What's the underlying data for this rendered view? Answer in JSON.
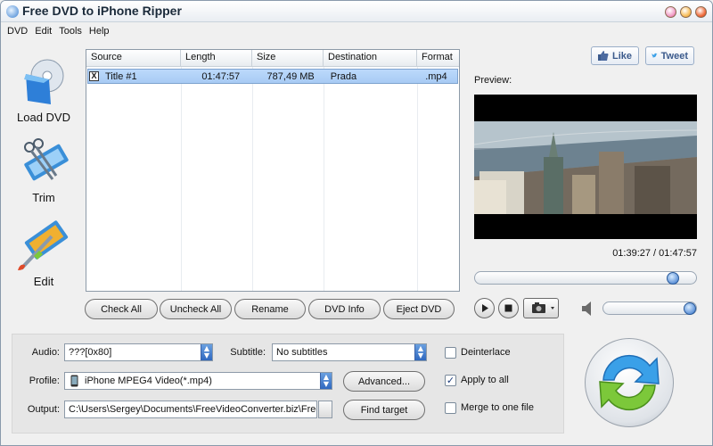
{
  "window": {
    "title": "Free DVD to iPhone Ripper"
  },
  "menu": [
    "DVD",
    "Edit",
    "Tools",
    "Help"
  ],
  "social": {
    "like": "Like",
    "tweet": "Tweet"
  },
  "sidebar": {
    "load": "Load DVD",
    "trim": "Trim",
    "edit": "Edit"
  },
  "table": {
    "columns": [
      "Source",
      "Length",
      "Size",
      "Destination",
      "Format"
    ],
    "rows": [
      {
        "checked": "X",
        "source": "Title #1",
        "length": "01:47:57",
        "size": "787,49 MB",
        "destination": "Prada",
        "format": ".mp4"
      }
    ]
  },
  "list_buttons": {
    "check_all": "Check All",
    "uncheck_all": "Uncheck All",
    "rename": "Rename",
    "dvd_info": "DVD Info",
    "eject": "Eject DVD"
  },
  "preview": {
    "label": "Preview:",
    "timecode": "01:39:27 / 01:47:57",
    "seek_fraction": 0.92,
    "volume_fraction": 1.0
  },
  "settings": {
    "audio_label": "Audio:",
    "audio_value": "???[0x80]",
    "subtitle_label": "Subtitle:",
    "subtitle_value": "No subtitles",
    "profile_label": "Profile:",
    "profile_value": "iPhone MPEG4 Video(*.mp4)",
    "advanced": "Advanced...",
    "output_label": "Output:",
    "output_value": "C:\\Users\\Sergey\\Documents\\FreeVideoConverter.biz\\Free",
    "find_target": "Find target",
    "deinterlace": "Deinterlace",
    "deinterlace_checked": "",
    "apply_all": "Apply to all",
    "apply_all_checked": "✓",
    "merge": "Merge to one file",
    "merge_checked": ""
  },
  "colors": {
    "selection": "#a8cbf4",
    "accent_blue": "#2f68c0",
    "convert_blue": "#3aa0e8",
    "convert_green": "#7cc83a"
  }
}
